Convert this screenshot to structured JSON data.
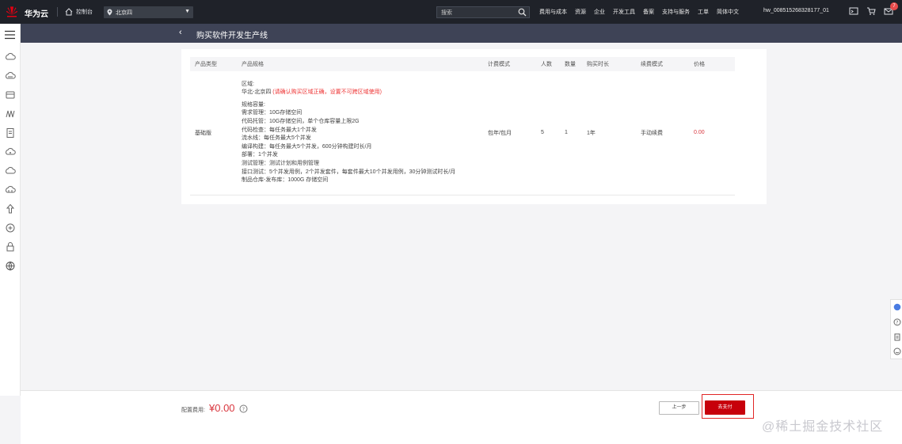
{
  "header": {
    "brand": "华为云",
    "console": "控制台",
    "region": "北京四",
    "search_placeholder": "搜索",
    "nav": [
      "费用与成本",
      "资源",
      "企业",
      "开发工具",
      "备案",
      "支持与服务",
      "工单",
      "简体中文"
    ],
    "account": "hw_008515268328177_01",
    "notification_count": "7"
  },
  "subheader": {
    "title": "购买软件开发生产线"
  },
  "table": {
    "columns": [
      "产品类型",
      "产品规格",
      "计费模式",
      "人数",
      "数量",
      "购买时长",
      "续费模式",
      "价格"
    ],
    "row": {
      "product_type": "基础版",
      "region_label": "区域:",
      "region_value": "华北-北京四",
      "region_note": "(请确认购买区域正确，设置不可跨区域使用)",
      "spec_title": "规格容量:",
      "specs": [
        "需求管理：10G存储空间",
        "代码托管：10G存储空间，单个仓库容量上限2G",
        "代码检查：每任务最大1个并发",
        "流水线：每任务最大5个并发",
        "编译构建：每任务最大5个并发，600分钟构建时长/月",
        "部署：1个并发",
        "测试管理：测试计划和用例管理",
        "接口测试：5个并发用例，2个并发套件，每套件最大10个并发用例，30分钟测试时长/月",
        "制品仓库-发布库：1000G 存储空间"
      ],
      "billing_mode": "包年/包月",
      "people": "5",
      "quantity": "1",
      "duration": "1年",
      "renew_mode": "手动续费",
      "price": "0.00"
    }
  },
  "footer": {
    "fee_label": "配置费用:",
    "fee_value": "¥0.00",
    "prev_label": "上一步",
    "pay_label": "去支付"
  },
  "watermark": "@稀土掘金技术社区",
  "colors": {
    "topbar": "#1f2229",
    "subheader": "#3e4356",
    "primary_red": "#c7000b",
    "price_red": "#d9363e"
  }
}
